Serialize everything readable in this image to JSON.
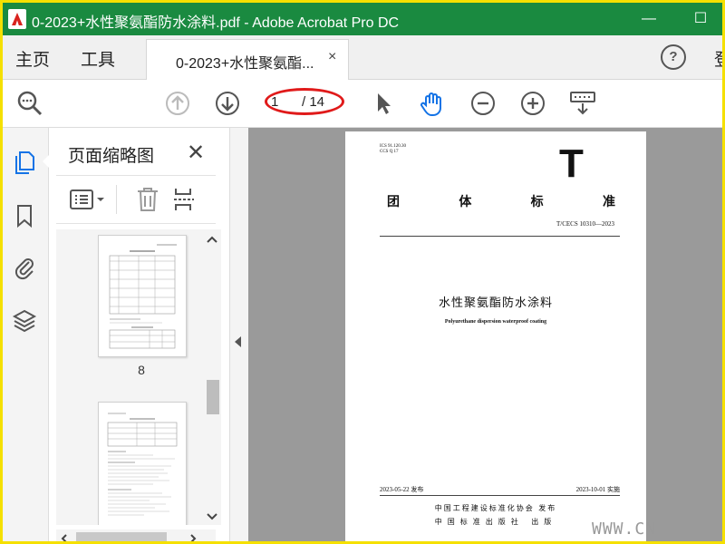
{
  "window": {
    "title": "0-2023+水性聚氨酯防水涂料.pdf - Adobe Acrobat Pro DC",
    "minimize": "—",
    "maximize": "☐"
  },
  "menu": {
    "home": "主页",
    "tools": "工具",
    "sign_in": "登"
  },
  "tab": {
    "label": "0-2023+水性聚氨酯...",
    "close": "×"
  },
  "help": "?",
  "toolbar": {
    "current_page": "1",
    "total_pages": "/ 14"
  },
  "thumbnails_panel": {
    "title": "页面缩略图",
    "close": "✕",
    "thumb_page_label": "8"
  },
  "document": {
    "codes": [
      "ICS 91.120.30",
      "CCS Q 17"
    ],
    "big_letter": "T",
    "org_chars": [
      "团",
      "体",
      "标",
      "准"
    ],
    "std_number": "T/CECS 10310—2023",
    "title_cn": "水性聚氨酯防水涂料",
    "title_en": "Polyurethane dispersion waterproof coating",
    "publish_date": "2023-05-22 发布",
    "implement_date": "2023-10-01 实施",
    "publisher_1": "中国工程建设标准化协会  发布",
    "publisher_2": "中国标准出版社  出版"
  },
  "watermark": "WWW.CN",
  "colors": {
    "title_bar": "#1a8a40",
    "frame": "#f5e000",
    "accent_blue": "#1473e6",
    "annotation_red": "#e01a1a"
  }
}
